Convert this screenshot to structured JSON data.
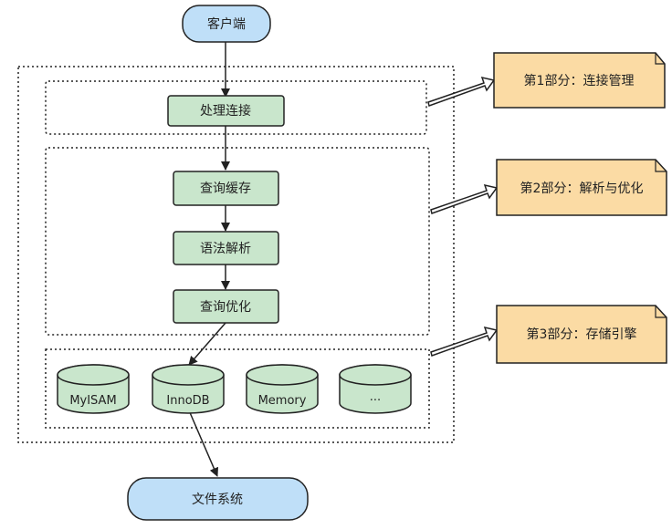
{
  "client": {
    "label": "客户端"
  },
  "filesystem": {
    "label": "文件系统"
  },
  "connection": {
    "process_label": "处理连接"
  },
  "parse": {
    "steps": [
      {
        "label": "查询缓存"
      },
      {
        "label": "语法解析"
      },
      {
        "label": "查询优化"
      }
    ]
  },
  "engines": [
    {
      "label": "MyISAM"
    },
    {
      "label": "InnoDB"
    },
    {
      "label": "Memory"
    },
    {
      "label": "···"
    }
  ],
  "notes": [
    {
      "label": "第1部分：连接管理"
    },
    {
      "label": "第2部分：解析与优化"
    },
    {
      "label": "第3部分：存储引擎"
    }
  ],
  "colors": {
    "terminal_fill": "#bfdff8",
    "process_fill": "#c9e6cc",
    "note_fill": "#fbdba4",
    "stroke": "#222222"
  }
}
